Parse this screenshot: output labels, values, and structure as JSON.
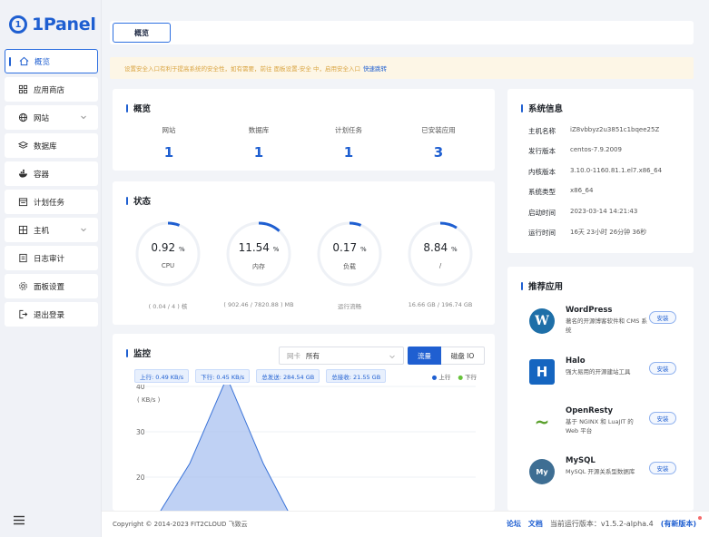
{
  "app": {
    "name": "1Panel",
    "logo_char": "1"
  },
  "sidebar": {
    "items": [
      {
        "label": "概览",
        "icon": "home-icon",
        "active": true
      },
      {
        "label": "应用商店",
        "icon": "grid-icon"
      },
      {
        "label": "网站",
        "icon": "globe-icon",
        "expandable": true
      },
      {
        "label": "数据库",
        "icon": "layers-icon"
      },
      {
        "label": "容器",
        "icon": "docker-icon"
      },
      {
        "label": "计划任务",
        "icon": "calendar-icon"
      },
      {
        "label": "主机",
        "icon": "server-icon",
        "expandable": true
      },
      {
        "label": "日志审计",
        "icon": "log-icon"
      },
      {
        "label": "面板设置",
        "icon": "gear-icon"
      },
      {
        "label": "退出登录",
        "icon": "logout-icon"
      }
    ]
  },
  "tabs": {
    "active": "概览"
  },
  "notice": {
    "text": "设置安全入口有利于提高系统的安全性，如有需要，前往 面板设置-安全 中，启用安全入口",
    "link": "快速跳转"
  },
  "overview": {
    "title": "概览",
    "items": [
      {
        "label": "网站",
        "value": "1"
      },
      {
        "label": "数据库",
        "value": "1"
      },
      {
        "label": "计划任务",
        "value": "1"
      },
      {
        "label": "已安装应用",
        "value": "3"
      }
    ]
  },
  "status": {
    "title": "状态",
    "gauges": [
      {
        "value": "0.92",
        "unit": "%",
        "label": "CPU",
        "sub": "( 0.04 / 4 ) 核",
        "percent": 0.0092
      },
      {
        "value": "11.54",
        "unit": "%",
        "label": "内存",
        "sub": "( 902.46 / 7820.88 ) MB",
        "percent": 0.1154
      },
      {
        "value": "0.17",
        "unit": "%",
        "label": "负载",
        "sub": "运行流畅",
        "percent": 0.0017
      },
      {
        "value": "8.84",
        "unit": "%",
        "label": "/",
        "sub": "16.66 GB / 196.74 GB",
        "percent": 0.0884
      }
    ]
  },
  "monitor": {
    "title": "监控",
    "nic_label": "网卡",
    "nic_value": "所有",
    "toggle_on": "流量",
    "toggle_off": "磁盘 IO",
    "chips": [
      "上行: 0.49 KB/s",
      "下行: 0.45 KB/s",
      "总发送: 284.54 GB",
      "总接收: 21.55 GB"
    ],
    "legend": [
      "上行",
      "下行"
    ]
  },
  "chart_data": {
    "type": "area",
    "ylabel": "( KB/s )",
    "yticks": [
      20,
      30,
      40
    ],
    "ylim": [
      12,
      42
    ],
    "series": [
      {
        "name": "上行",
        "values": [
          5,
          10,
          23,
          42,
          23,
          8,
          4
        ]
      }
    ],
    "colors": {
      "up": "#1f5fd1",
      "down": "#67c23a"
    }
  },
  "system": {
    "title": "系统信息",
    "rows": [
      {
        "k": "主机名称",
        "v": "iZ8vbbyz2u3851c1bqee25Z"
      },
      {
        "k": "发行版本",
        "v": "centos-7.9.2009"
      },
      {
        "k": "内核版本",
        "v": "3.10.0-1160.81.1.el7.x86_64"
      },
      {
        "k": "系统类型",
        "v": "x86_64"
      },
      {
        "k": "启动时间",
        "v": "2023-03-14 14:21:43"
      },
      {
        "k": "运行时间",
        "v": "16天 23小时 26分钟 36秒"
      }
    ]
  },
  "apps": {
    "title": "推荐应用",
    "install_label": "安装",
    "items": [
      {
        "name": "WordPress",
        "desc": "著名的开源博客软件和 CMS 系统",
        "icon": "wordpress-icon",
        "color": "#1e6fa8",
        "glyph": "W"
      },
      {
        "name": "Halo",
        "desc": "强大易用的开源建站工具",
        "icon": "halo-icon",
        "color": "#1565c0",
        "glyph": "H"
      },
      {
        "name": "OpenResty",
        "desc": "基于 NGINX 和 LuaJIT 的 Web 平台",
        "icon": "openresty-icon",
        "color": "#5aa02c",
        "glyph": "~"
      },
      {
        "name": "MySQL",
        "desc": "MySQL 开源关系型数据库",
        "icon": "mysql-icon",
        "color": "#3e6e93",
        "glyph": "My"
      }
    ]
  },
  "footer": {
    "copyright": "Copyright © 2014-2023 FIT2CLOUD 飞致云",
    "forum": "论坛",
    "docs": "文档",
    "version_label": "当前运行版本：",
    "version": "v1.5.2-alpha.4",
    "new_version": "(有新版本)"
  },
  "colors": {
    "accent": "#1f5fd1",
    "notice_text": "#d9a441",
    "notice_bg": "#fdf6e6"
  }
}
